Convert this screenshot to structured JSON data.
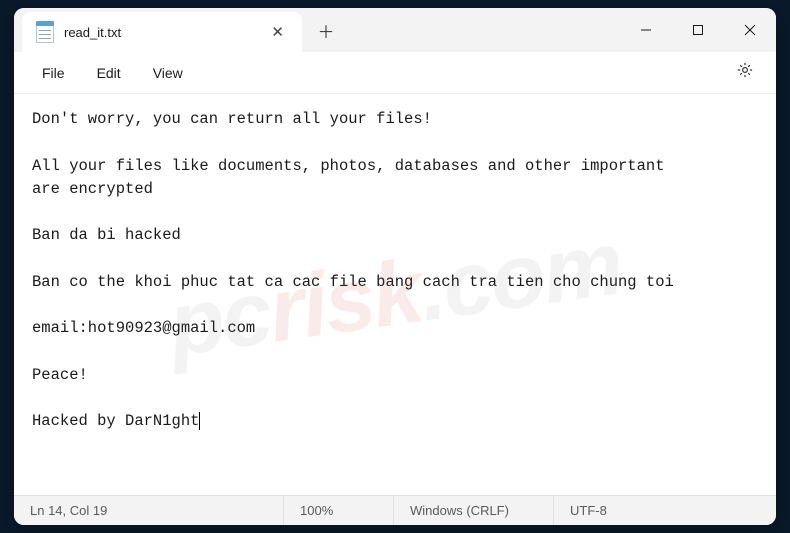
{
  "tab": {
    "title": "read_it.txt"
  },
  "menu": {
    "file": "File",
    "edit": "Edit",
    "view": "View"
  },
  "content": {
    "text": "Don't worry, you can return all your files!\n\nAll your files like documents, photos, databases and other important\nare encrypted\n\nBan da bi hacked\n\nBan co the khoi phuc tat ca cac file bang cach tra tien cho chung toi\n\nemail:hot90923@gmail.com\n\nPeace!\n\nHacked by DarN1ght"
  },
  "status": {
    "position": "Ln 14, Col 19",
    "zoom": "100%",
    "eol": "Windows (CRLF)",
    "encoding": "UTF-8"
  }
}
